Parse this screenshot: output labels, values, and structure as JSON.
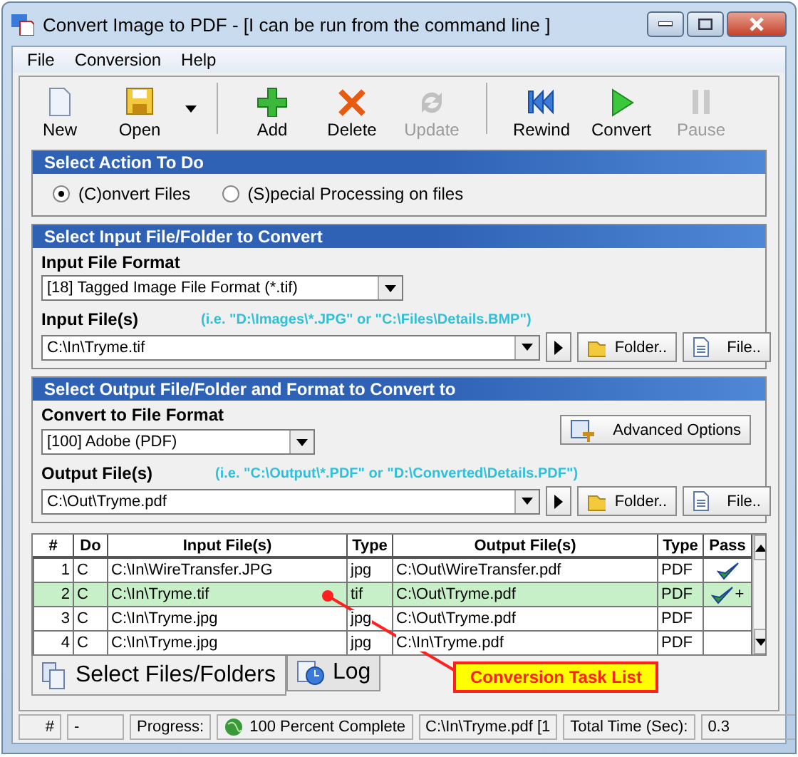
{
  "window": {
    "title": "Convert Image to PDF - [I can be run from the command line ]"
  },
  "menu": [
    "File",
    "Conversion",
    "Help"
  ],
  "toolbar": [
    {
      "label": "New",
      "kind": "new",
      "disabled": false
    },
    {
      "label": "Open",
      "kind": "open",
      "disabled": false
    },
    {
      "kind": "dropdown"
    },
    {
      "kind": "separator"
    },
    {
      "label": "Add",
      "kind": "add",
      "disabled": false
    },
    {
      "label": "Delete",
      "kind": "delete",
      "disabled": false
    },
    {
      "label": "Update",
      "kind": "update",
      "disabled": true
    },
    {
      "kind": "separator"
    },
    {
      "label": "Rewind",
      "kind": "rewind",
      "disabled": false
    },
    {
      "label": "Convert",
      "kind": "convert",
      "disabled": false
    },
    {
      "label": "Pause",
      "kind": "pause",
      "disabled": true
    }
  ],
  "action_section": {
    "title": "Select Action To Do",
    "options": [
      {
        "label": "(C)onvert Files",
        "selected": true
      },
      {
        "label": "(S)pecial Processing on files",
        "selected": false
      }
    ]
  },
  "input_section": {
    "title": "Select Input File/Folder to Convert",
    "format_label": "Input File Format",
    "format_value": "[18] Tagged Image File Format (*.tif)",
    "files_label": "Input File(s)",
    "files_hint": "(i.e. \"D:\\Images\\*.JPG\"  or \"C:\\Files\\Details.BMP\")",
    "files_value": "C:\\In\\Tryme.tif",
    "folder_button": "Folder..",
    "file_button": "File.."
  },
  "output_section": {
    "title": "Select Output File/Folder and Format to Convert to",
    "format_label": "Convert to File Format",
    "format_value": "[100] Adobe (PDF)",
    "advanced_button": "Advanced Options",
    "files_label": "Output File(s)",
    "files_hint": "(i.e. \"C:\\Output\\*.PDF\" or \"D:\\Converted\\Details.PDF\")",
    "files_value": "C:\\Out\\Tryme.pdf",
    "folder_button": "Folder..",
    "file_button": "File.."
  },
  "table": {
    "columns": [
      "#",
      "Do",
      "Input File(s)",
      "Type",
      "Output File(s)",
      "Type",
      "Pass"
    ],
    "rows": [
      {
        "cells": [
          "1",
          "C",
          "C:\\In\\WireTransfer.JPG",
          "jpg",
          "C:\\Out\\WireTransfer.pdf",
          "PDF"
        ],
        "passed": true,
        "pass_note": "",
        "selected": false
      },
      {
        "cells": [
          "2",
          "C",
          "C:\\In\\Tryme.tif",
          "tif",
          "C:\\Out\\Tryme.pdf",
          "PDF"
        ],
        "passed": true,
        "pass_note": "+",
        "selected": true
      },
      {
        "cells": [
          "3",
          "C",
          "C:\\In\\Tryme.jpg",
          "jpg",
          "C:\\Out\\Tryme.pdf",
          "PDF"
        ],
        "passed": false,
        "pass_note": "",
        "selected": false
      },
      {
        "cells": [
          "4",
          "C",
          "C:\\In\\Tryme.jpg",
          "jpg",
          "C:\\In\\Tryme.pdf",
          "PDF"
        ],
        "passed": false,
        "pass_note": "",
        "selected": false
      }
    ]
  },
  "callout": "Conversion Task List",
  "tabs": [
    {
      "label": "Select Files/Folders",
      "selected": true
    },
    {
      "label": "Log",
      "selected": false
    }
  ],
  "status_bar": [
    "#",
    "-",
    "Progress:",
    "100 Percent Complete",
    "C:\\In\\Tryme.pdf [1",
    "Total Time (Sec):",
    "0.3"
  ]
}
